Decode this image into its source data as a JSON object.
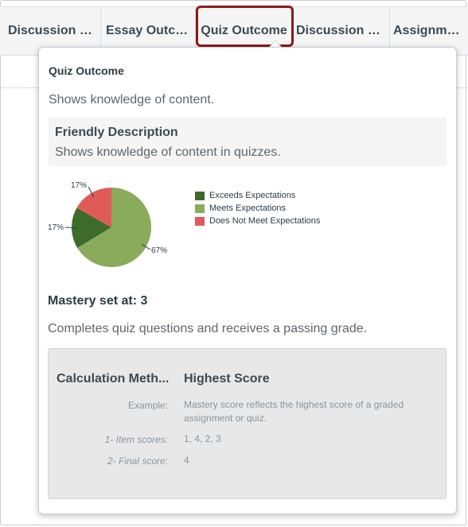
{
  "columns": [
    {
      "label": "Discussion Outcome",
      "display": "Discussion O..."
    },
    {
      "label": "Essay Outcome",
      "display": "Essay Outco..."
    },
    {
      "label": "Quiz Outcome",
      "display": "Quiz Outcome"
    },
    {
      "label": "Discussion Outcome",
      "display": "Discussion O..."
    },
    {
      "label": "Assignment",
      "display": "Assignment"
    }
  ],
  "popover": {
    "title": "Quiz Outcome",
    "description": "Shows knowledge of content.",
    "friendly_title": "Friendly Description",
    "friendly_text": "Shows knowledge of content in quizzes.",
    "mastery": "Mastery set at: 3",
    "mastery_desc": "Completes quiz questions and receives a passing grade.",
    "calc": {
      "title": "Calculation Method",
      "title_display": "Calculation Meth...",
      "value": "Highest Score",
      "example_label": "Example:",
      "example_text": "Mastery score reflects the highest score of a graded assignment or quiz.",
      "item_label": "1- Item scores:",
      "item_value": "1, 4, 2, 3",
      "final_label": "2- Final score:",
      "final_value": "4"
    }
  },
  "chart_data": {
    "type": "pie",
    "slices": [
      {
        "label": "Exceeds Expectations",
        "value": 17,
        "display": "17%",
        "color": "#3d6b2c"
      },
      {
        "label": "Meets Expectations",
        "value": 67,
        "display": "67%",
        "color": "#8aab5b"
      },
      {
        "label": "Does Not Meet Expectations",
        "value": 17,
        "display": "17%",
        "color": "#e05a5a"
      }
    ],
    "legend_position": "right"
  }
}
